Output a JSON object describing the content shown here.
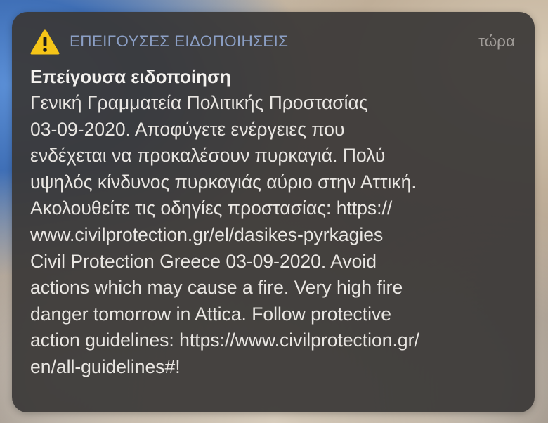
{
  "notification": {
    "app_name": "ΕΠΕΙΓΟΥΣΕΣ ΕΙΔΟΠΟΙΗΣΕΙΣ",
    "time": "τώρα",
    "icon": "warning-triangle-icon",
    "title": "Επείγουσα ειδοποίηση",
    "body": "Γενική Γραμματεία Πολιτικής Προστασίας\n03-09-2020. Αποφύγετε ενέργειες που\nενδέχεται να προκαλέσουν πυρκαγιά. Πολύ\nυψηλός κίνδυνος πυρκαγιάς αύριο στην Αττική.\nΑκολουθείτε τις οδηγίες προστασίας: https://\nwww.civilprotection.gr/el/dasikes-pyrkagies\nCivil Protection Greece 03-09-2020. Avoid\nactions which may cause a fire. Very high fire\ndanger tomorrow in Attica. Follow protective\naction guidelines: https://www.civilprotection.gr/\nen/all-guidelines#!"
  },
  "colors": {
    "icon_yellow": "#f5c518",
    "app_name": "#8b9fc5",
    "card_background": "#3a3837"
  }
}
